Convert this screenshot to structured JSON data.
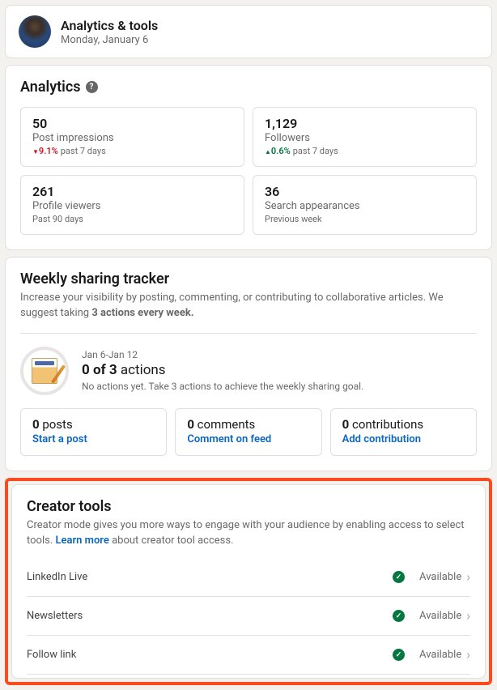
{
  "header": {
    "title": "Analytics & tools",
    "date": "Monday, January 6"
  },
  "analytics": {
    "heading": "Analytics",
    "metrics": {
      "impressions": {
        "value": "50",
        "label": "Post impressions",
        "delta": "9.1%",
        "period": "past 7 days"
      },
      "followers": {
        "value": "1,129",
        "label": "Followers",
        "delta": "0.6%",
        "period": "past 7 days"
      },
      "viewers": {
        "value": "261",
        "label": "Profile viewers",
        "period": "Past 90 days"
      },
      "search": {
        "value": "36",
        "label": "Search appearances",
        "period": "Previous week"
      }
    }
  },
  "tracker": {
    "heading": "Weekly sharing tracker",
    "sub_pre": "Increase your visibility by posting, commenting, or contributing to collaborative articles. We suggest taking ",
    "sub_bold": "3 actions every week.",
    "date_range": "Jan 6-Jan 12",
    "count_bold": "0 of 3",
    "count_rest": " actions",
    "hint": "No actions yet. Take 3 actions to achieve the weekly sharing goal.",
    "actions": {
      "posts": {
        "num": "0",
        "word": " posts",
        "link": "Start a post"
      },
      "comments": {
        "num": "0",
        "word": " comments",
        "link": "Comment on feed"
      },
      "contributions": {
        "num": "0",
        "word": " contributions",
        "link": "Add contribution"
      }
    }
  },
  "creator": {
    "heading": "Creator tools",
    "sub_pre": "Creator mode gives you more ways to engage with your audience by enabling access to select tools. ",
    "learn": "Learn more",
    "sub_post": " about creator tool access.",
    "available": "Available",
    "tools": {
      "live": "LinkedIn Live",
      "news": "Newsletters",
      "follow": "Follow link"
    }
  }
}
